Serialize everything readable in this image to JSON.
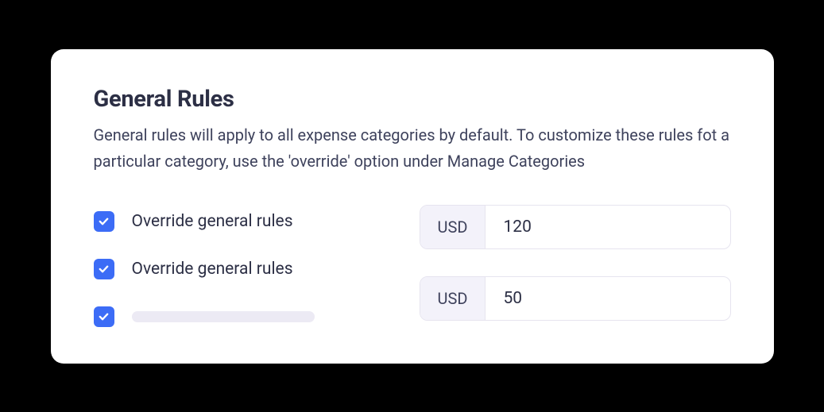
{
  "title": "General Rules",
  "description": "General rules will apply to all expense categories by default. To customize these rules fot a particular category, use the 'override' option under Manage Categories",
  "checkboxes": [
    {
      "label": "Override general rules",
      "checked": true
    },
    {
      "label": "Override general rules",
      "checked": true
    },
    {
      "label": "",
      "checked": true
    }
  ],
  "currency_inputs": [
    {
      "prefix": "USD",
      "value": "120"
    },
    {
      "prefix": "USD",
      "value": "50"
    }
  ]
}
